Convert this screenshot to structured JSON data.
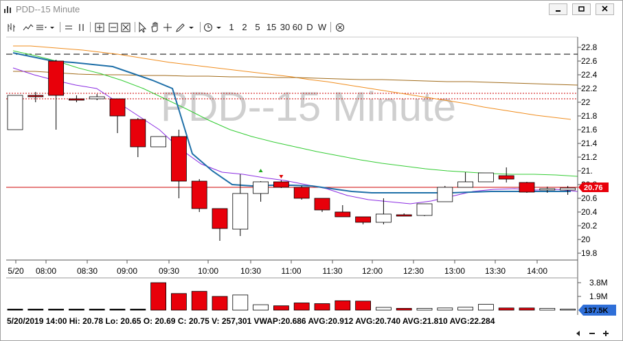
{
  "window": {
    "title": "PDD--15 Minute"
  },
  "toolbar": {
    "periods": [
      "1",
      "2",
      "5",
      "15",
      "30",
      "60",
      "D",
      "W"
    ]
  },
  "chart_data": {
    "type": "candlestick",
    "title": "PDD--15 Minute",
    "y_ticks": [
      "22.8",
      "22.6",
      "22.4",
      "22.2",
      "22",
      "21.8",
      "21.6",
      "21.4",
      "21.2",
      "21.",
      "20.8",
      "20.6",
      "20.4",
      "20.2",
      "20",
      "19.8"
    ],
    "ylim": [
      19.7,
      22.95
    ],
    "x_ticks": [
      "5/20",
      "08:00",
      "08:30",
      "09:00",
      "09:30",
      "10:00",
      "10:30",
      "11:00",
      "11:30",
      "12:00",
      "12:30",
      "13:00",
      "13:30",
      "14:00"
    ],
    "current_price_label": "20.76",
    "candles": [
      {
        "o": 21.6,
        "h": 22.1,
        "l": 21.6,
        "c": 22.1
      },
      {
        "o": 22.1,
        "h": 22.15,
        "l": 22.0,
        "c": 22.08
      },
      {
        "o": 22.6,
        "h": 22.62,
        "l": 21.6,
        "c": 22.1
      },
      {
        "o": 22.05,
        "h": 22.1,
        "l": 22.0,
        "c": 22.03
      },
      {
        "o": 22.05,
        "h": 22.12,
        "l": 22.03,
        "c": 22.08
      },
      {
        "o": 22.05,
        "h": 22.05,
        "l": 21.55,
        "c": 21.8
      },
      {
        "o": 21.75,
        "h": 21.77,
        "l": 21.2,
        "c": 21.35
      },
      {
        "o": 21.35,
        "h": 21.5,
        "l": 21.35,
        "c": 21.5
      },
      {
        "o": 21.5,
        "h": 21.6,
        "l": 20.6,
        "c": 20.85
      },
      {
        "o": 20.85,
        "h": 20.88,
        "l": 20.4,
        "c": 20.45
      },
      {
        "o": 20.45,
        "h": 20.45,
        "l": 19.98,
        "c": 20.16
      },
      {
        "o": 20.15,
        "h": 20.95,
        "l": 20.05,
        "c": 20.67
      },
      {
        "o": 20.67,
        "h": 20.85,
        "l": 20.55,
        "c": 20.84
      },
      {
        "o": 20.84,
        "h": 20.86,
        "l": 20.75,
        "c": 20.76
      },
      {
        "o": 20.76,
        "h": 20.78,
        "l": 20.58,
        "c": 20.6
      },
      {
        "o": 20.6,
        "h": 20.6,
        "l": 20.4,
        "c": 20.43
      },
      {
        "o": 20.4,
        "h": 20.5,
        "l": 20.33,
        "c": 20.33
      },
      {
        "o": 20.33,
        "h": 20.33,
        "l": 20.22,
        "c": 20.25
      },
      {
        "o": 20.25,
        "h": 20.6,
        "l": 20.22,
        "c": 20.37
      },
      {
        "o": 20.36,
        "h": 20.38,
        "l": 20.34,
        "c": 20.34
      },
      {
        "o": 20.35,
        "h": 20.52,
        "l": 20.34,
        "c": 20.52
      },
      {
        "o": 20.55,
        "h": 20.78,
        "l": 20.55,
        "c": 20.76
      },
      {
        "o": 20.76,
        "h": 20.98,
        "l": 20.76,
        "c": 20.84
      },
      {
        "o": 20.84,
        "h": 20.97,
        "l": 20.84,
        "c": 20.97
      },
      {
        "o": 20.93,
        "h": 21.05,
        "l": 20.83,
        "c": 20.88
      },
      {
        "o": 20.83,
        "h": 20.84,
        "l": 20.68,
        "c": 20.69
      },
      {
        "o": 20.72,
        "h": 20.77,
        "l": 20.68,
        "c": 20.74
      },
      {
        "o": 20.72,
        "h": 20.78,
        "l": 20.65,
        "c": 20.75
      }
    ],
    "lines": [
      {
        "color": "#000000",
        "dash": true,
        "values": [
          22.7,
          22.7
        ]
      },
      {
        "color": "#cc0000",
        "dash": true,
        "values": [
          22.13,
          22.13
        ]
      },
      {
        "color": "#cc0000",
        "dash": true,
        "values": [
          22.05,
          22.05
        ]
      },
      {
        "color": "#cc0000",
        "dash": false,
        "values": [
          20.76,
          20.76
        ]
      },
      {
        "color": "#f08c1c",
        "dash": false,
        "values": [
          22.82,
          22.82,
          22.8,
          22.78,
          22.76,
          22.73,
          22.7,
          22.66,
          22.62,
          22.58,
          22.55,
          22.52,
          22.49,
          22.46,
          22.43,
          22.4,
          22.37,
          22.33,
          22.3,
          22.26,
          22.22,
          22.18,
          22.14,
          22.1,
          22.06,
          22.02,
          21.98,
          21.93,
          21.89,
          21.85,
          21.81,
          21.78,
          21.75
        ]
      },
      {
        "color": "#a06a18",
        "dash": false,
        "values": [
          22.45,
          22.45,
          22.43,
          22.41,
          22.4,
          22.4,
          22.39,
          22.39,
          22.38,
          22.38,
          22.37,
          22.37,
          22.36,
          22.36,
          22.35,
          22.34,
          22.33,
          22.33,
          22.32,
          22.31,
          22.3,
          22.3,
          22.29,
          22.28,
          22.27,
          22.26,
          22.25
        ]
      },
      {
        "color": "#33cc33",
        "dash": false,
        "values": [
          22.75,
          22.68,
          22.6,
          22.5,
          22.42,
          22.32,
          22.2,
          22.05,
          21.9,
          21.74,
          21.6,
          21.5,
          21.42,
          21.35,
          21.28,
          21.22,
          21.16,
          21.11,
          21.07,
          21.03,
          21.0,
          20.98,
          20.96,
          20.95,
          20.95,
          20.94,
          20.92
        ]
      },
      {
        "color": "#8a2be2",
        "dash": false,
        "values": [
          22.5,
          22.4,
          22.32,
          22.25,
          22.2,
          22.0,
          21.8,
          21.6,
          21.32,
          21.1,
          20.98,
          20.95,
          20.9,
          20.86,
          20.8,
          20.74,
          20.64,
          20.58,
          20.55,
          20.52,
          20.56,
          20.63,
          20.7,
          20.73,
          20.74,
          20.72,
          20.73,
          20.7
        ]
      },
      {
        "color": "#1e6fa8",
        "dash": false,
        "values": [
          22.72,
          22.66,
          22.6,
          22.58,
          22.55,
          22.52,
          22.42,
          22.32,
          22.2,
          21.25,
          21.0,
          20.8,
          20.78,
          20.79,
          20.79,
          20.78,
          20.74,
          20.7,
          20.68,
          20.68,
          20.68,
          20.68,
          20.68,
          20.69,
          20.7,
          20.7,
          20.7,
          20.7,
          20.7
        ]
      }
    ],
    "volume": {
      "ticks": [
        "3.8M",
        "1.9M"
      ],
      "max": 3.8,
      "current_label": "137.5K",
      "values": [
        0.04,
        0.05,
        0.05,
        0.04,
        0.05,
        0.04,
        0.05,
        0.04,
        3.8,
        2.3,
        2.6,
        1.9,
        2.1,
        0.75,
        0.6,
        1.0,
        0.9,
        1.3,
        1.25,
        0.38,
        0.25,
        0.25,
        0.3,
        0.4,
        0.8,
        0.3,
        0.3,
        0.25,
        0.14
      ]
    }
  },
  "status": {
    "text": "5/20/2019 14:00   Hi: 20.78   Lo: 20.65   O: 20.69   C: 20.75   V: 257,301  VWAP:20.686  AVG:20.912  AVG:20.740  AVG:21.810  AVG:22.284"
  },
  "colors": {
    "down": "#e8000a",
    "up": "#ffffff",
    "axis_label_bg": "#e8000a",
    "volume_label_bg": "#2f6fd8"
  }
}
